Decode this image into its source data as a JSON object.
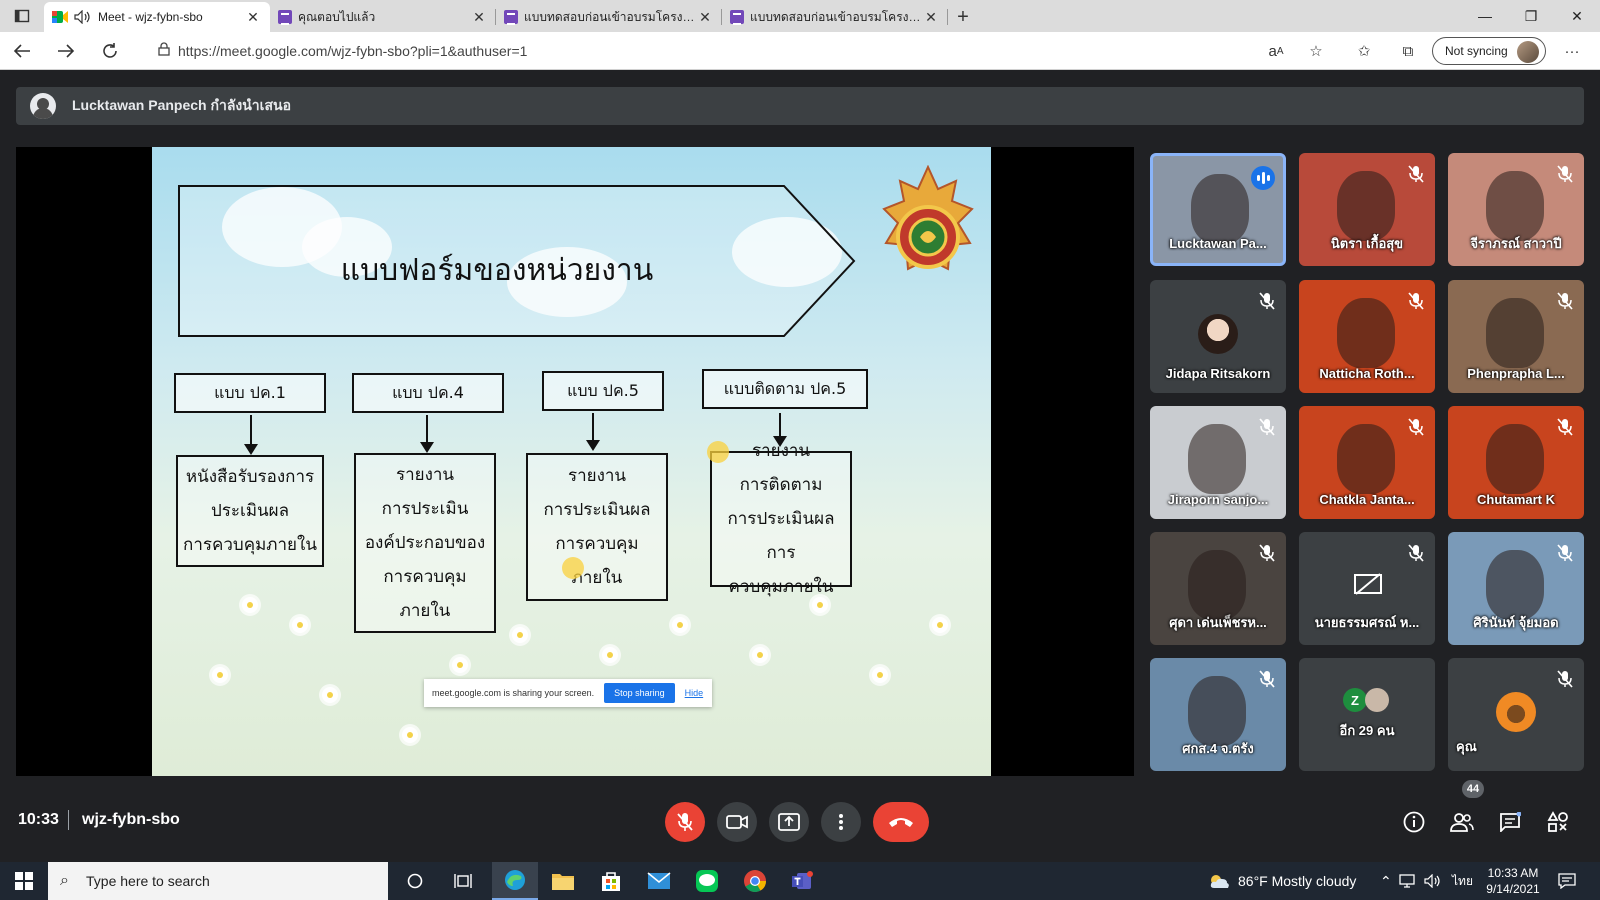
{
  "browser": {
    "tabs": [
      {
        "title": "Meet - wjz-fybn-sbo",
        "active": true,
        "icon": "google-meet-icon",
        "audio": true
      },
      {
        "title": "คุณตอบไปแล้ว",
        "active": false,
        "icon": "google-forms-icon"
      },
      {
        "title": "แบบทดสอบก่อนเข้าอบรมโครงการ \"อบ",
        "active": false,
        "icon": "google-forms-icon"
      },
      {
        "title": "แบบทดสอบก่อนเข้าอบรมโครงการ \"อบ",
        "active": false,
        "icon": "google-forms-icon"
      }
    ],
    "url": "https://meet.google.com/wjz-fybn-sbo?pli=1&authuser=1",
    "sync_label": "Not syncing"
  },
  "banner": {
    "text": "Lucktawan Panpech กำลังนำเสนอ"
  },
  "slide": {
    "title": "แบบฟอร์มของหน่วยงาน",
    "columns": [
      {
        "header": "แบบ ปค.1",
        "body": "หนังสือรับรองการ\nประเมินผล\nการควบคุมภายใน"
      },
      {
        "header": "แบบ ปค.4",
        "body": "รายงาน\nการประเมิน\nองค์ประกอบของ\nการควบคุม\nภายใน"
      },
      {
        "header": "แบบ ปค.5",
        "body": "รายงาน\nการประเมินผล\nการควบคุม\nภายใน"
      },
      {
        "header": "แบบติดตาม ปค.5",
        "body": "รายงาน\nการติดตาม\nการประเมินผลการ\nควบคุมภายใน"
      }
    ],
    "share_notice": "meet.google.com is sharing your screen.",
    "stop_label": "Stop sharing",
    "hide_label": "Hide"
  },
  "participants": [
    {
      "name": "Lucktawan Pa...",
      "speaking": true,
      "muted": false,
      "bg": "#8a96a6"
    },
    {
      "name": "นิตรา เกื้อสุข",
      "muted": true,
      "bg": "#b84a3a"
    },
    {
      "name": "จีราภรณ์ สาวาปี",
      "muted": true,
      "bg": "#c58a7a"
    },
    {
      "name": "Jidapa Ritsakorn",
      "muted": true,
      "bg": "#3c4043",
      "avatar": true
    },
    {
      "name": "Natticha Roth...",
      "muted": true,
      "bg": "#c8441e"
    },
    {
      "name": "Phenprapha L...",
      "muted": true,
      "bg": "#8a6a52"
    },
    {
      "name": "Jiraporn sanjo...",
      "muted": true,
      "bg": "#c9ccd0"
    },
    {
      "name": "Chatkla Janta...",
      "muted": true,
      "bg": "#c8441e"
    },
    {
      "name": "Chutamart K",
      "muted": true,
      "bg": "#c8441e"
    },
    {
      "name": "ศุดา เด่นเพ็ชรห...",
      "muted": true,
      "bg": "#4a4440"
    },
    {
      "name": "นายธรรมศรณ์ ห...",
      "muted": true,
      "bg": "#3c4043",
      "camera_off": true
    },
    {
      "name": "ศิรินันท์ จุ้ยมอด",
      "muted": true,
      "bg": "#7a9ab8"
    },
    {
      "name": "ศกส.4 จ.ตรัง",
      "muted": true,
      "bg": "#6a8aa8"
    },
    {
      "name": "อีก 29 คน",
      "muted": false,
      "bg": "#3c4043",
      "others": true,
      "others_initial": "Z"
    },
    {
      "name": "คุณ",
      "muted": true,
      "bg": "#3c4043",
      "self": true
    }
  ],
  "meeting": {
    "time": "10:33",
    "code": "wjz-fybn-sbo",
    "people_count": "44"
  },
  "taskbar": {
    "search_placeholder": "Type here to search",
    "weather": "86°F  Mostly cloudy",
    "lang": "ไทย",
    "time": "10:33 AM",
    "date": "9/14/2021"
  },
  "colors": {
    "meet_bg": "#202124",
    "end_call": "#ea4335",
    "speaking_border": "#8ab4f8",
    "accent": "#1a73e8"
  }
}
